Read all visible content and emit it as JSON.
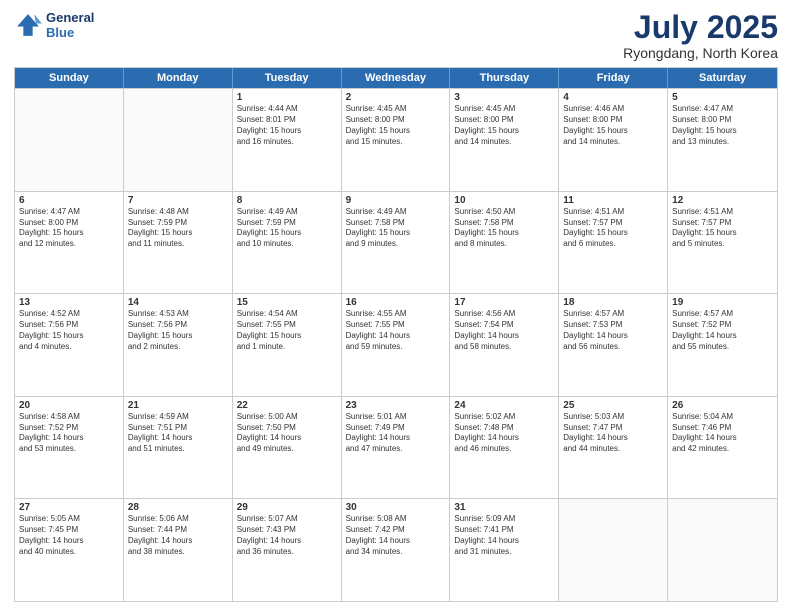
{
  "logo": {
    "line1": "General",
    "line2": "Blue"
  },
  "title": "July 2025",
  "location": "Ryongdang, North Korea",
  "days_of_week": [
    "Sunday",
    "Monday",
    "Tuesday",
    "Wednesday",
    "Thursday",
    "Friday",
    "Saturday"
  ],
  "weeks": [
    [
      {
        "day": "",
        "info": ""
      },
      {
        "day": "",
        "info": ""
      },
      {
        "day": "1",
        "info": "Sunrise: 4:44 AM\nSunset: 8:01 PM\nDaylight: 15 hours\nand 16 minutes."
      },
      {
        "day": "2",
        "info": "Sunrise: 4:45 AM\nSunset: 8:00 PM\nDaylight: 15 hours\nand 15 minutes."
      },
      {
        "day": "3",
        "info": "Sunrise: 4:45 AM\nSunset: 8:00 PM\nDaylight: 15 hours\nand 14 minutes."
      },
      {
        "day": "4",
        "info": "Sunrise: 4:46 AM\nSunset: 8:00 PM\nDaylight: 15 hours\nand 14 minutes."
      },
      {
        "day": "5",
        "info": "Sunrise: 4:47 AM\nSunset: 8:00 PM\nDaylight: 15 hours\nand 13 minutes."
      }
    ],
    [
      {
        "day": "6",
        "info": "Sunrise: 4:47 AM\nSunset: 8:00 PM\nDaylight: 15 hours\nand 12 minutes."
      },
      {
        "day": "7",
        "info": "Sunrise: 4:48 AM\nSunset: 7:59 PM\nDaylight: 15 hours\nand 11 minutes."
      },
      {
        "day": "8",
        "info": "Sunrise: 4:49 AM\nSunset: 7:59 PM\nDaylight: 15 hours\nand 10 minutes."
      },
      {
        "day": "9",
        "info": "Sunrise: 4:49 AM\nSunset: 7:58 PM\nDaylight: 15 hours\nand 9 minutes."
      },
      {
        "day": "10",
        "info": "Sunrise: 4:50 AM\nSunset: 7:58 PM\nDaylight: 15 hours\nand 8 minutes."
      },
      {
        "day": "11",
        "info": "Sunrise: 4:51 AM\nSunset: 7:57 PM\nDaylight: 15 hours\nand 6 minutes."
      },
      {
        "day": "12",
        "info": "Sunrise: 4:51 AM\nSunset: 7:57 PM\nDaylight: 15 hours\nand 5 minutes."
      }
    ],
    [
      {
        "day": "13",
        "info": "Sunrise: 4:52 AM\nSunset: 7:56 PM\nDaylight: 15 hours\nand 4 minutes."
      },
      {
        "day": "14",
        "info": "Sunrise: 4:53 AM\nSunset: 7:56 PM\nDaylight: 15 hours\nand 2 minutes."
      },
      {
        "day": "15",
        "info": "Sunrise: 4:54 AM\nSunset: 7:55 PM\nDaylight: 15 hours\nand 1 minute."
      },
      {
        "day": "16",
        "info": "Sunrise: 4:55 AM\nSunset: 7:55 PM\nDaylight: 14 hours\nand 59 minutes."
      },
      {
        "day": "17",
        "info": "Sunrise: 4:56 AM\nSunset: 7:54 PM\nDaylight: 14 hours\nand 58 minutes."
      },
      {
        "day": "18",
        "info": "Sunrise: 4:57 AM\nSunset: 7:53 PM\nDaylight: 14 hours\nand 56 minutes."
      },
      {
        "day": "19",
        "info": "Sunrise: 4:57 AM\nSunset: 7:52 PM\nDaylight: 14 hours\nand 55 minutes."
      }
    ],
    [
      {
        "day": "20",
        "info": "Sunrise: 4:58 AM\nSunset: 7:52 PM\nDaylight: 14 hours\nand 53 minutes."
      },
      {
        "day": "21",
        "info": "Sunrise: 4:59 AM\nSunset: 7:51 PM\nDaylight: 14 hours\nand 51 minutes."
      },
      {
        "day": "22",
        "info": "Sunrise: 5:00 AM\nSunset: 7:50 PM\nDaylight: 14 hours\nand 49 minutes."
      },
      {
        "day": "23",
        "info": "Sunrise: 5:01 AM\nSunset: 7:49 PM\nDaylight: 14 hours\nand 47 minutes."
      },
      {
        "day": "24",
        "info": "Sunrise: 5:02 AM\nSunset: 7:48 PM\nDaylight: 14 hours\nand 46 minutes."
      },
      {
        "day": "25",
        "info": "Sunrise: 5:03 AM\nSunset: 7:47 PM\nDaylight: 14 hours\nand 44 minutes."
      },
      {
        "day": "26",
        "info": "Sunrise: 5:04 AM\nSunset: 7:46 PM\nDaylight: 14 hours\nand 42 minutes."
      }
    ],
    [
      {
        "day": "27",
        "info": "Sunrise: 5:05 AM\nSunset: 7:45 PM\nDaylight: 14 hours\nand 40 minutes."
      },
      {
        "day": "28",
        "info": "Sunrise: 5:06 AM\nSunset: 7:44 PM\nDaylight: 14 hours\nand 38 minutes."
      },
      {
        "day": "29",
        "info": "Sunrise: 5:07 AM\nSunset: 7:43 PM\nDaylight: 14 hours\nand 36 minutes."
      },
      {
        "day": "30",
        "info": "Sunrise: 5:08 AM\nSunset: 7:42 PM\nDaylight: 14 hours\nand 34 minutes."
      },
      {
        "day": "31",
        "info": "Sunrise: 5:09 AM\nSunset: 7:41 PM\nDaylight: 14 hours\nand 31 minutes."
      },
      {
        "day": "",
        "info": ""
      },
      {
        "day": "",
        "info": ""
      }
    ]
  ]
}
